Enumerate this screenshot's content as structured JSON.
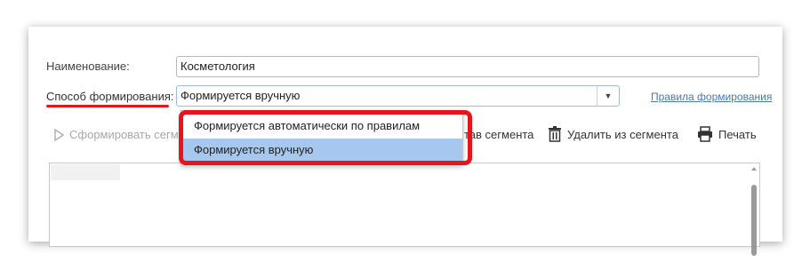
{
  "form": {
    "name_label": "Наименование:",
    "name_value": "Косметология",
    "method_label": "Способ формирования:",
    "method_value": "Формируется вручную",
    "rules_link": "Правила формирования"
  },
  "dropdown": {
    "options": [
      {
        "label": "Формируется автоматически по правилам",
        "selected": false
      },
      {
        "label": "Формируется вручную",
        "selected": true
      }
    ]
  },
  "toolbar": {
    "generate_label": "Сформировать сегм",
    "composition_label": "тав сегмента",
    "remove_label": "Удалить из сегмента",
    "print_label": "Печать"
  },
  "icons": {
    "play": "play-icon",
    "trash": "trash-icon",
    "printer": "printer-icon",
    "dropdown": "chevron-down-icon"
  },
  "colors": {
    "annotation_red": "#e8141c",
    "selected_option": "#a6c8ee",
    "link": "#4a78b0"
  }
}
